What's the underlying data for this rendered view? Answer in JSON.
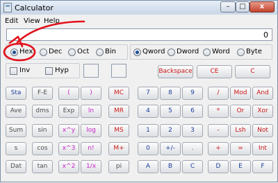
{
  "window": {
    "title": "Calculator"
  },
  "titlebar_buttons": {
    "minimize": "–",
    "maximize": "□",
    "close": "x"
  },
  "menu": {
    "items": [
      "Edit",
      "View",
      "Help"
    ]
  },
  "display": {
    "value": "0"
  },
  "base": {
    "options": [
      {
        "label": "Hex",
        "checked": true
      },
      {
        "label": "Dec",
        "checked": false
      },
      {
        "label": "Oct",
        "checked": false
      },
      {
        "label": "Bin",
        "checked": false
      }
    ]
  },
  "word_size": {
    "options": [
      {
        "label": "Qword",
        "checked": true
      },
      {
        "label": "Dword",
        "checked": false
      },
      {
        "label": "Word",
        "checked": false
      },
      {
        "label": "Byte",
        "checked": false
      }
    ]
  },
  "modifiers": {
    "inv": "Inv",
    "hyp": "Hyp"
  },
  "edit_keys": {
    "backspace": "Backspace",
    "ce": "CE",
    "c": "C"
  },
  "colors": {
    "blue_key": "#1b3e9c",
    "red_key": "#cc1616",
    "magenta_key": "#c624c6",
    "gray_key": "#4c4c4c",
    "annotation": "#e3101a"
  },
  "keys": [
    [
      {
        "label": "Sta",
        "color": "blue"
      },
      {
        "label": "F-E",
        "color": "gray"
      },
      {
        "label": "(",
        "color": "magenta"
      },
      {
        "label": ")",
        "color": "magenta"
      },
      {
        "label": "MC",
        "color": "red"
      },
      {
        "label": "7",
        "color": "blue"
      },
      {
        "label": "8",
        "color": "blue"
      },
      {
        "label": "9",
        "color": "blue"
      },
      {
        "label": "/",
        "color": "red"
      },
      {
        "label": "Mod",
        "color": "red"
      },
      {
        "label": "And",
        "color": "red"
      }
    ],
    [
      {
        "label": "Ave",
        "color": "gray"
      },
      {
        "label": "dms",
        "color": "gray"
      },
      {
        "label": "Exp",
        "color": "gray"
      },
      {
        "label": "ln",
        "color": "magenta"
      },
      {
        "label": "MR",
        "color": "red"
      },
      {
        "label": "4",
        "color": "blue"
      },
      {
        "label": "5",
        "color": "blue"
      },
      {
        "label": "6",
        "color": "blue"
      },
      {
        "label": "*",
        "color": "red"
      },
      {
        "label": "Or",
        "color": "red"
      },
      {
        "label": "Xor",
        "color": "red"
      }
    ],
    [
      {
        "label": "Sum",
        "color": "gray"
      },
      {
        "label": "sin",
        "color": "gray"
      },
      {
        "label": "x^y",
        "color": "magenta"
      },
      {
        "label": "log",
        "color": "magenta"
      },
      {
        "label": "MS",
        "color": "red"
      },
      {
        "label": "1",
        "color": "blue"
      },
      {
        "label": "2",
        "color": "blue"
      },
      {
        "label": "3",
        "color": "blue"
      },
      {
        "label": "-",
        "color": "red"
      },
      {
        "label": "Lsh",
        "color": "red"
      },
      {
        "label": "Not",
        "color": "red"
      }
    ],
    [
      {
        "label": "s",
        "color": "gray"
      },
      {
        "label": "cos",
        "color": "gray"
      },
      {
        "label": "x^3",
        "color": "magenta"
      },
      {
        "label": "n!",
        "color": "magenta"
      },
      {
        "label": "M+",
        "color": "red"
      },
      {
        "label": "0",
        "color": "blue"
      },
      {
        "label": "+/-",
        "color": "blue"
      },
      {
        "label": ".",
        "color": "gray"
      },
      {
        "label": "+",
        "color": "red"
      },
      {
        "label": "=",
        "color": "red"
      },
      {
        "label": "Int",
        "color": "red"
      }
    ],
    [
      {
        "label": "Dat",
        "color": "gray"
      },
      {
        "label": "tan",
        "color": "gray"
      },
      {
        "label": "x^2",
        "color": "magenta"
      },
      {
        "label": "1/x",
        "color": "magenta"
      },
      {
        "label": "pi",
        "color": "gray"
      },
      {
        "label": "A",
        "color": "blue"
      },
      {
        "label": "B",
        "color": "blue"
      },
      {
        "label": "C",
        "color": "blue"
      },
      {
        "label": "D",
        "color": "blue"
      },
      {
        "label": "E",
        "color": "blue"
      },
      {
        "label": "F",
        "color": "blue"
      }
    ]
  ]
}
